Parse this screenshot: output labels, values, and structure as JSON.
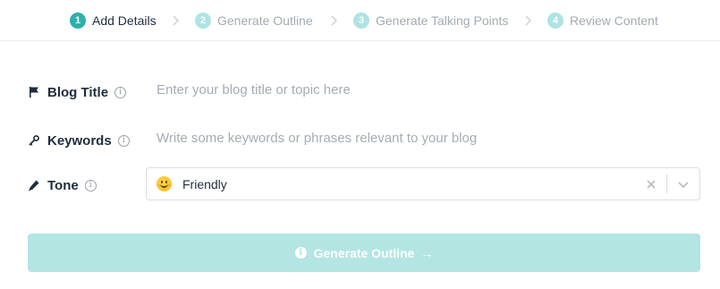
{
  "stepper": {
    "steps": [
      {
        "number": "1",
        "label": "Add Details",
        "state": "active"
      },
      {
        "number": "2",
        "label": "Generate Outline",
        "state": "inactive"
      },
      {
        "number": "3",
        "label": "Generate Talking Points",
        "state": "inactive"
      },
      {
        "number": "4",
        "label": "Review Content",
        "state": "inactive"
      }
    ]
  },
  "form": {
    "blog_title": {
      "label": "Blog Title",
      "icon": "flag-icon",
      "info_glyph": "i",
      "placeholder": "Enter your blog title or topic here",
      "value": ""
    },
    "keywords": {
      "label": "Keywords",
      "icon": "key-icon",
      "info_glyph": "i",
      "placeholder": "Write some keywords or phrases relevant to your blog",
      "value": ""
    },
    "tone": {
      "label": "Tone",
      "icon": "pen-icon",
      "info_glyph": "i",
      "selected": "Friendly",
      "emoji": "smiling-face"
    }
  },
  "generate_button": {
    "label": "Generate Outline",
    "icon_glyph": "i",
    "arrow": "→",
    "enabled": false
  },
  "colors": {
    "accent": "#2bb1ac",
    "accent_light": "#aee4e2",
    "button_disabled": "#b3e5e3"
  }
}
